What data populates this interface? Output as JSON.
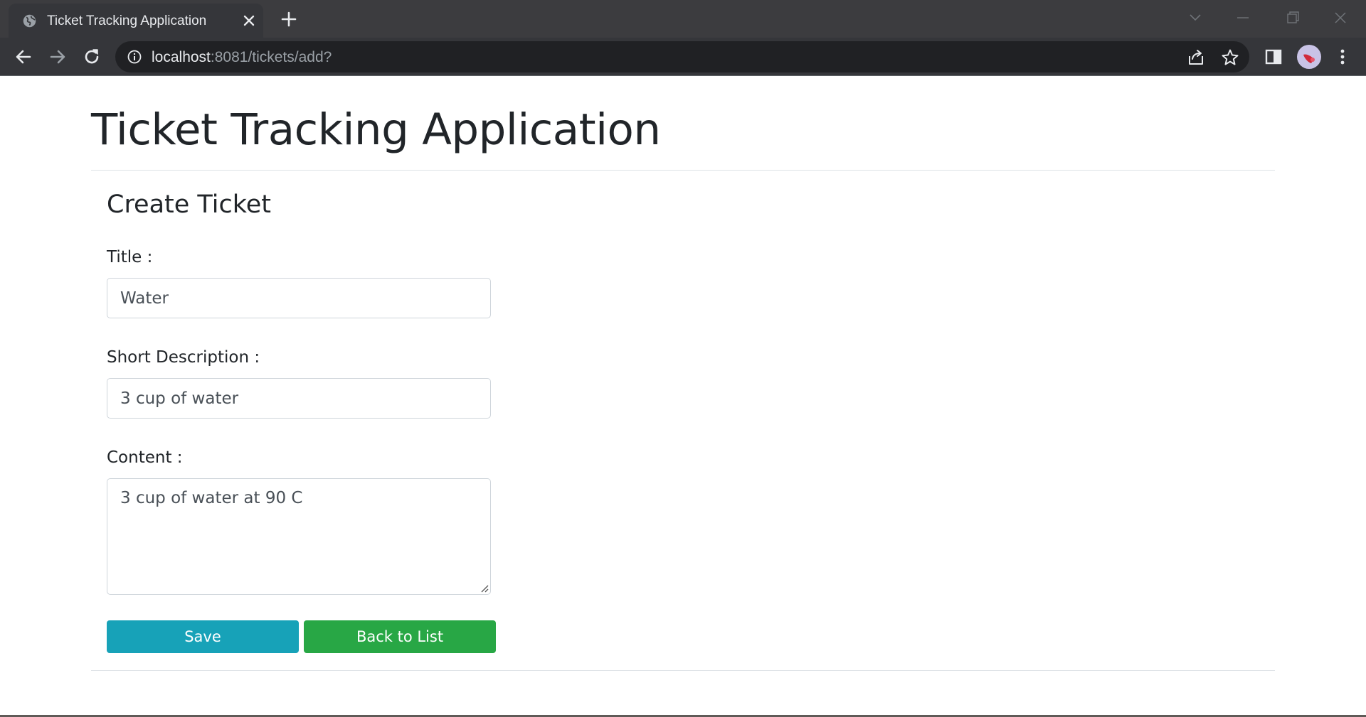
{
  "browser": {
    "tab_title": "Ticket Tracking Application",
    "url_host": "localhost",
    "url_rest": ":8081/tickets/add?",
    "colors": {
      "tabbar": "#3c3c3f",
      "toolbar": "#35363a",
      "omnibox": "#202124"
    }
  },
  "page": {
    "app_title": "Ticket Tracking Application",
    "form_title": "Create Ticket",
    "fields": {
      "title": {
        "label": "Title :",
        "value": "Water"
      },
      "short_description": {
        "label": "Short Description :",
        "value": "3 cup of water"
      },
      "content": {
        "label": "Content :",
        "value": "3 cup of water at 90 C"
      }
    },
    "buttons": {
      "save": "Save",
      "back": "Back to List"
    },
    "colors": {
      "save": "#17a2b8",
      "back": "#28a745",
      "text": "#212529"
    }
  },
  "icons": [
    "globe-icon",
    "close-icon",
    "plus-icon",
    "chevron-down-icon",
    "minimize-icon",
    "restore-icon",
    "window-close-icon",
    "back-arrow-icon",
    "forward-arrow-icon",
    "reload-icon",
    "info-icon",
    "share-icon",
    "star-icon",
    "side-panel-icon",
    "avatar",
    "more-icon"
  ]
}
